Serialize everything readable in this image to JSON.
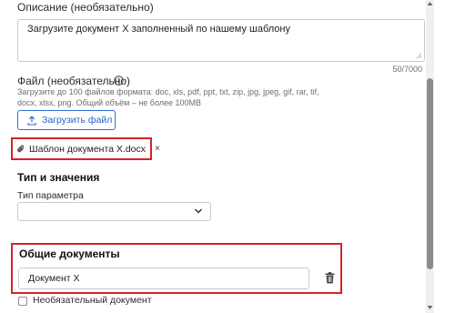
{
  "description": {
    "label": "Описание (необязательно)",
    "value": "Загрузите документ Х заполненный по нашему шаблону",
    "counter": "50/7000"
  },
  "file": {
    "label": "Файл (необязательно)",
    "info_icon": "info-circle-icon",
    "hint": "Загрузите до 100 файлов формата: doc, xls, pdf, ppt, txt, zip, jpg, jpeg, gif, rar, tif, docx, xlsx, png. Общий объём – не более 100MB",
    "upload_label": "Загрузить файл",
    "upload_icon": "upload-icon",
    "attached": {
      "name": "Шаблон документа X.docx",
      "icon": "paperclip-icon",
      "remove": "×"
    }
  },
  "types": {
    "title": "Тип и значения",
    "param_label": "Тип параметра",
    "param_value": "",
    "chevron_icon": "chevron-down-icon"
  },
  "common_docs": {
    "title": "Общие документы",
    "doc_value": "Документ Х",
    "delete_icon": "trash-icon",
    "optional_label": "Необязательный документ",
    "optional_checked": false
  },
  "colors": {
    "accent": "#2f6cd6",
    "highlight": "#d6222a",
    "border": "#c9c9c9"
  }
}
